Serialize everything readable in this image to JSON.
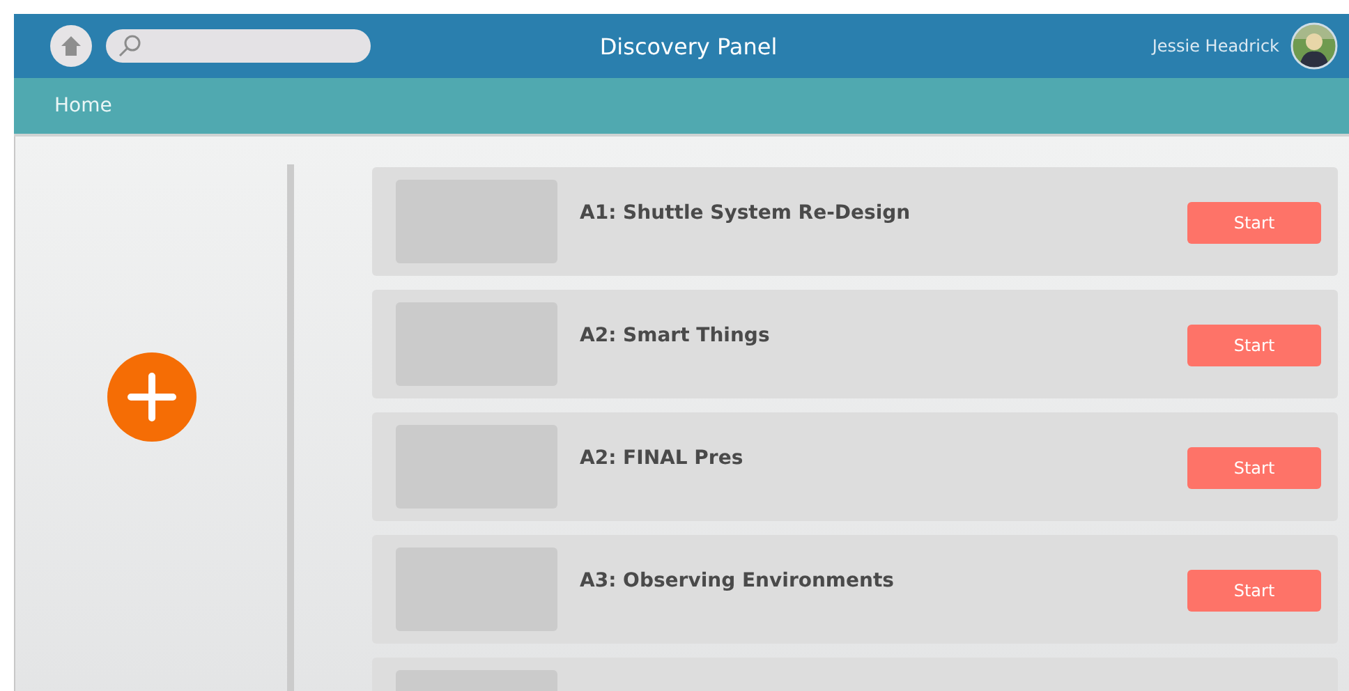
{
  "header": {
    "title": "Discovery Panel",
    "user_name": "Jessie Headrick"
  },
  "breadcrumb": "Home",
  "cards": [
    {
      "kind": "full",
      "title": "A1: Shuttle System Re-Design",
      "button": "Start"
    },
    {
      "kind": "full",
      "title": "A2: Smart Things",
      "button": "Start"
    },
    {
      "kind": "full",
      "title": "A2: FINAL Pres",
      "button": "Start"
    },
    {
      "kind": "full",
      "title": "A3: Observing Environments",
      "button": "Start"
    },
    {
      "kind": "cut_off"
    }
  ]
}
